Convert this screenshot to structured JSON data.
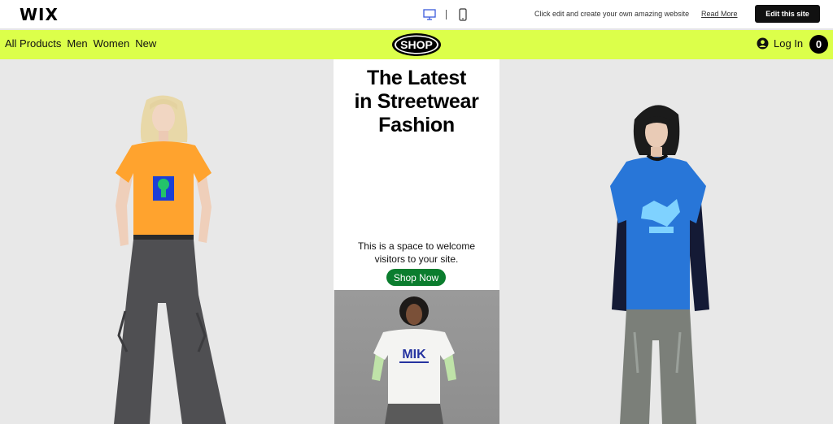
{
  "wix_bar": {
    "logo": "WIX",
    "promo_text": "Click edit and create your own amazing website",
    "read_more": "Read More",
    "edit_button": "Edit this site"
  },
  "header": {
    "nav": [
      "All Products",
      "Men",
      "Women",
      "New"
    ],
    "brand": "SHOP",
    "login": "Log In",
    "cart_count": "0"
  },
  "hero": {
    "headline_lines": [
      "The Latest",
      "in Streetwear",
      "Fashion"
    ],
    "welcome_lines": [
      "This is a space to welcome",
      "visitors to your site."
    ],
    "cta": "Shop Now",
    "center_shirt_text": "MIK"
  },
  "colors": {
    "header_bg": "#dcff4a",
    "cta_bg": "#0b7d2e",
    "edit_button_bg": "#111111"
  }
}
